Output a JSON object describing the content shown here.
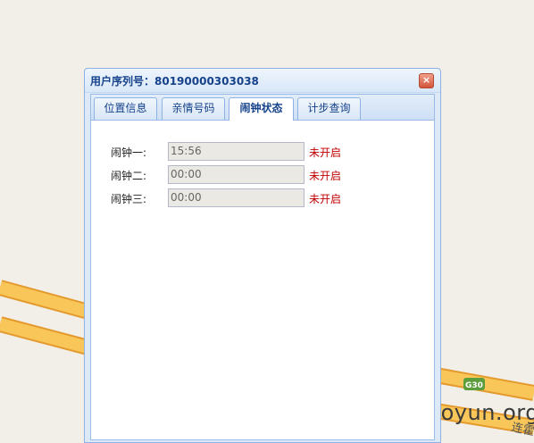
{
  "dialog": {
    "title": "用户序列号：80190000303038",
    "close_glyph": "×"
  },
  "tabs": [
    {
      "label": "位置信息",
      "active": false
    },
    {
      "label": "亲情号码",
      "active": false
    },
    {
      "label": "闹钟状态",
      "active": true
    },
    {
      "label": "计步查询",
      "active": false
    }
  ],
  "alarms": [
    {
      "label": "闹钟一:",
      "time": "15:56",
      "status": "未开启"
    },
    {
      "label": "闹钟二:",
      "time": "00:00",
      "status": "未开启"
    },
    {
      "label": "闹钟三:",
      "time": "00:00",
      "status": "未开启"
    }
  ],
  "map": {
    "road_badge": "G30",
    "road_label": "连霍"
  },
  "watermark": "www.wooyun.org",
  "colors": {
    "road": "#f9c65a",
    "road_edge": "#e49a2c",
    "badge": "#5d9e3c",
    "status": "#c00000",
    "title": "#15428b"
  }
}
